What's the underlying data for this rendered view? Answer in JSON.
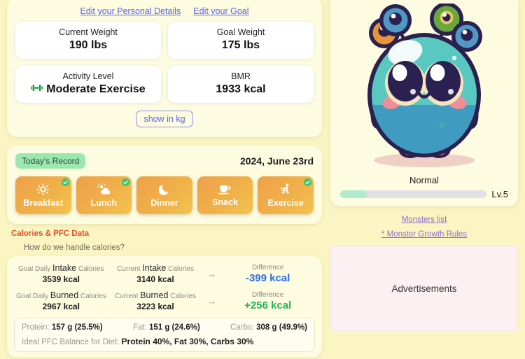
{
  "theme": {
    "page_bg": "#faf5c2",
    "panel_bg": "#fdfbe0",
    "link_blue": "#5b63e8",
    "link_purple": "#8b6fd0",
    "accent_orange": "#e2542a",
    "diff_negative": "#2f6bed",
    "diff_positive": "#20b85a",
    "meal_card": "#f0b049",
    "badge_green": "#9ce6b0"
  },
  "profile": {
    "edit_links": [
      {
        "label": "Edit your Personal Details",
        "name": "edit-personal-details-link"
      },
      {
        "label": "Edit your Goal",
        "name": "edit-goal-link"
      }
    ],
    "stats": [
      {
        "label": "Current Weight",
        "value": "190 lbs",
        "icon": ""
      },
      {
        "label": "Goal Weight",
        "value": "175 lbs",
        "icon": ""
      },
      {
        "label": "Activity Level",
        "value": "Moderate Exercise",
        "icon": "dumbbell-icon"
      },
      {
        "label": "BMR",
        "value": "1933 kcal",
        "icon": ""
      }
    ],
    "unit_toggle_label": "show in kg"
  },
  "record": {
    "badge": "Today's Record",
    "date": "2024, June 23rd",
    "meals": [
      {
        "label": "Breakfast",
        "icon": "sun-icon",
        "glyph": "☀",
        "checked": true
      },
      {
        "label": "Lunch",
        "icon": "sun-behind-cloud-icon",
        "glyph": "⛅",
        "checked": true
      },
      {
        "label": "Dinner",
        "icon": "moon-icon",
        "glyph": "☾",
        "checked": false
      },
      {
        "label": "Snack",
        "icon": "coffee-cup-icon",
        "glyph": "☕",
        "checked": false
      },
      {
        "label": "Exercise",
        "icon": "running-person-icon",
        "glyph": "🏃",
        "checked": true
      }
    ]
  },
  "calories": {
    "section_title": "Calories & PFC Data",
    "help_link": "How do we handle calories?",
    "rows": [
      {
        "goal_prefix": "Goal Daily",
        "goal_strong": "Intake",
        "goal_suffix": "Calories",
        "goal_value": "3539 kcal",
        "current_prefix": "Current",
        "current_strong": "Intake",
        "current_suffix": "Calories",
        "current_value": "3140 kcal",
        "arrow": "→",
        "diff_label": "Difference",
        "diff_value": "-399 kcal",
        "diff_sign": "negative"
      },
      {
        "goal_prefix": "Goal Daily",
        "goal_strong": "Burned",
        "goal_suffix": "Calories",
        "goal_value": "2967 kcal",
        "current_prefix": "Current",
        "current_strong": "Burned",
        "current_suffix": "Calories",
        "current_value": "3223 kcal",
        "arrow": "→",
        "diff_label": "Difference",
        "diff_value": "+256 kcal",
        "diff_sign": "positive"
      }
    ],
    "pfc": {
      "protein_label": "Protein:",
      "protein_value": "157 g (25.5%)",
      "fat_label": "Fat:",
      "fat_value": "151 g (24.6%)",
      "carbs_label": "Carbs:",
      "carbs_value": "308 g (49.9%)",
      "ideal_label": "Ideal PFC Balance for Diet:",
      "ideal_value": "Protein 40%, Fat 30%, Carbs 30%"
    }
  },
  "monster": {
    "state": "Normal",
    "level": "Lv.5",
    "progress_percent": 18,
    "links": [
      {
        "label": "Monsters list",
        "name": "monsters-list-link"
      },
      {
        "label": "* Monster Growth Rules",
        "name": "monster-growth-rules-link"
      }
    ]
  },
  "ads": {
    "label": "Advertisements"
  }
}
